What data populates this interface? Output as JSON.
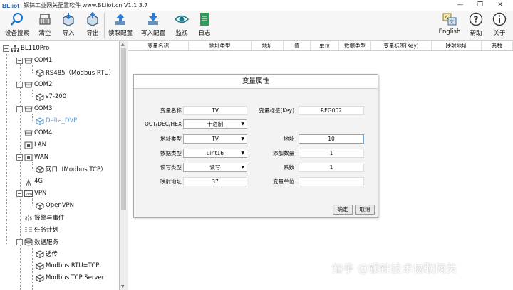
{
  "titlebar": {
    "logo": "BLiiot",
    "title": "钡铼工业网关配置软件 www.BLiiot.cn V1.1.3.7",
    "min": "—",
    "restore": "❐",
    "close": "✕"
  },
  "toolbar": {
    "search": "设备搜索",
    "clear": "清空",
    "import": "导入",
    "export": "导出",
    "read_config": "读取配置",
    "write_config": "写入配置",
    "monitor": "监视",
    "log": "日志",
    "english": "English",
    "help": "帮助",
    "about": "关于"
  },
  "tree": {
    "root": "BL110Pro",
    "com1": "COM1",
    "com1_child": "RS485（Modbus RTU）",
    "com2": "COM2",
    "com2_child": "s7-200",
    "com3": "COM3",
    "com3_child": "Delta_DVP",
    "com4": "COM4",
    "lan": "LAN",
    "wan": "WAN",
    "wan_child": "网口（Modbus TCP）",
    "g4": "4G",
    "vpn": "VPN",
    "vpn_child": "OpenVPN",
    "alarm": "报警与事件",
    "task": "任务计划",
    "data_service": "数据服务",
    "ds1": "透传",
    "ds2": "Modbus RTU=TCP",
    "ds3": "Modbus TCP Server"
  },
  "grid_headers": [
    "变量名称",
    "地址类型",
    "地址",
    "值",
    "单位",
    "数据类型",
    "变量标签(Key)",
    "映射地址",
    "系数"
  ],
  "dialog": {
    "title": "变量属性",
    "var_name_label": "变量名称",
    "var_name": "TV",
    "key_label": "变量标签(Key)",
    "key": "REG002",
    "base_label": "OCT/DEC/HEX",
    "base": "十进制",
    "addr_type_label": "地址类型",
    "addr_type": "TV",
    "addr_label": "地址",
    "addr": "10",
    "dtype_label": "数据类型",
    "dtype": "uint16",
    "add_count_label": "添加数量",
    "add_count": "1",
    "rw_label": "读写类型",
    "rw": "读写",
    "coef_label": "系数",
    "coef": "1",
    "map_label": "映射地址",
    "map": "37",
    "unit_label": "变量单位",
    "unit": "",
    "ok": "确定",
    "cancel": "取消"
  },
  "watermark": "知乎 @钡铼技术物联网关"
}
